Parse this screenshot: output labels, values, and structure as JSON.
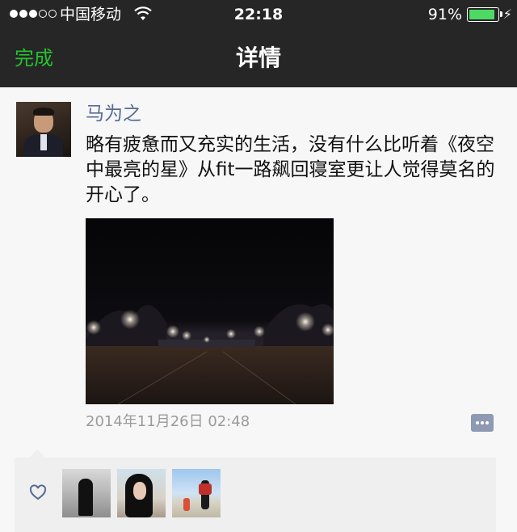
{
  "status_bar": {
    "carrier": "中国移动",
    "time": "22:18",
    "battery": "91%",
    "battery_level": 0.91
  },
  "nav": {
    "done_label": "完成",
    "title": "详情"
  },
  "post": {
    "author": "马为之",
    "text": "略有疲惫而又充实的生活，没有什么比听着《夜空中最亮的星》从fit一路飙回寝室更让人觉得莫名的开心了。",
    "timestamp": "2014年11月26日 02:48"
  },
  "likes": {
    "count_shown": 3
  },
  "icons": {
    "signal": "signal-dots-icon",
    "wifi": "wifi-icon",
    "battery": "battery-icon",
    "charging": "charging-bolt-icon",
    "comment": "comment-icon",
    "like": "heart-icon"
  },
  "colors": {
    "nav_background": "#262626",
    "done_green": "#25c12f",
    "author_blue": "#576b95",
    "battery_green": "#4cd964"
  }
}
